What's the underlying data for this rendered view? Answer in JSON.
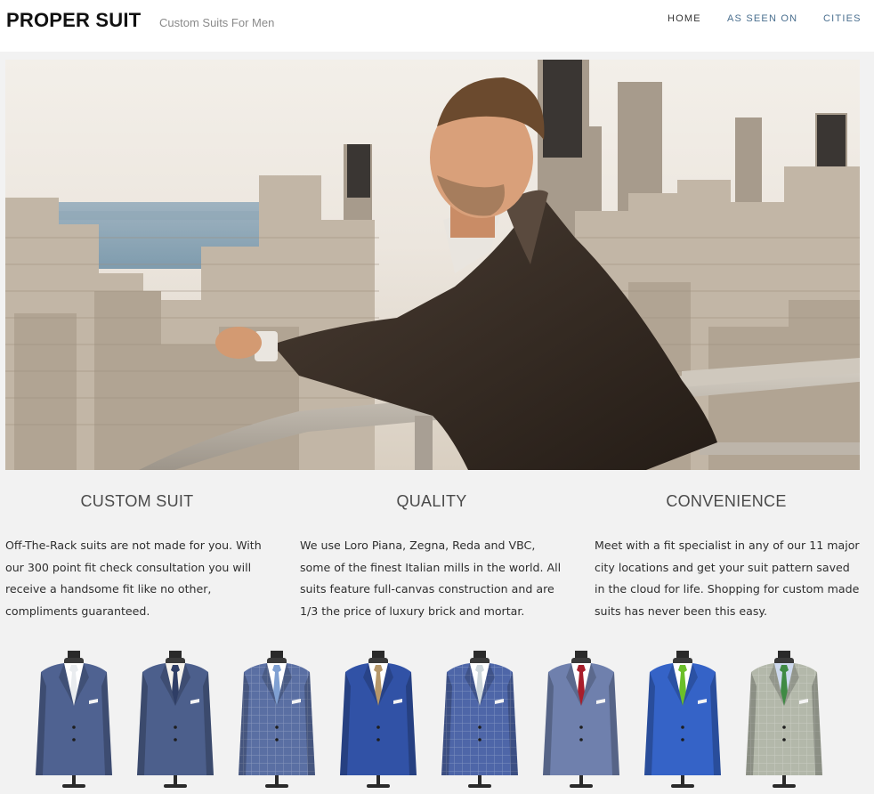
{
  "header": {
    "logo": "PROPER SUIT",
    "tagline": "Custom Suits For Men",
    "nav": {
      "home": "HOME",
      "as_seen_on": "AS SEEN ON",
      "cities": "CITIES"
    }
  },
  "features": [
    {
      "title": "CUSTOM SUIT",
      "body": "Off-The-Rack suits are not made for you. With our 300 point fit check consultation you will receive a handsome fit like no other, compliments guaranteed."
    },
    {
      "title": "QUALITY",
      "body": "We  use Loro Piana, Zegna, Reda and VBC, some of the finest Italian mills in the world. All suits feature full-canvas construction and are 1/3 the price of luxury brick and mortar."
    },
    {
      "title": "CONVENIENCE",
      "body": "Meet with a fit specialist in any of our 11 major city locations and get your  suit pattern saved in the cloud for life. Shopping for custom made suits has never been this easy."
    }
  ],
  "colors": {
    "nav_active": "#333333",
    "nav_link": "#4a6f8f",
    "page_bg": "#f2f2f2"
  },
  "suits": [
    {
      "jacket": "#4f6291",
      "tie": "#e9ecef",
      "shirt": "#ffffff",
      "pattern": "plain"
    },
    {
      "jacket": "#4c5f8c",
      "tie": "#2f3e66",
      "shirt": "#f5f2ec",
      "pattern": "plain"
    },
    {
      "jacket": "#5a6fa3",
      "tie": "#7fa0d2",
      "shirt": "#ffffff",
      "pattern": "check"
    },
    {
      "jacket": "#3152a6",
      "tie": "#b5976a",
      "shirt": "#ffffff",
      "pattern": "plain"
    },
    {
      "jacket": "#4e66a8",
      "tie": "#cfd8dd",
      "shirt": "#ffffff",
      "pattern": "check"
    },
    {
      "jacket": "#6f80ad",
      "tie": "#a81e2b",
      "shirt": "#ffffff",
      "pattern": "plain"
    },
    {
      "jacket": "#3563c7",
      "tie": "#6bbf2a",
      "shirt": "#ffffff",
      "pattern": "plain"
    },
    {
      "jacket": "#b3b8aa",
      "tie": "#3f8a44",
      "shirt": "#cdd9ee",
      "pattern": "check"
    }
  ]
}
